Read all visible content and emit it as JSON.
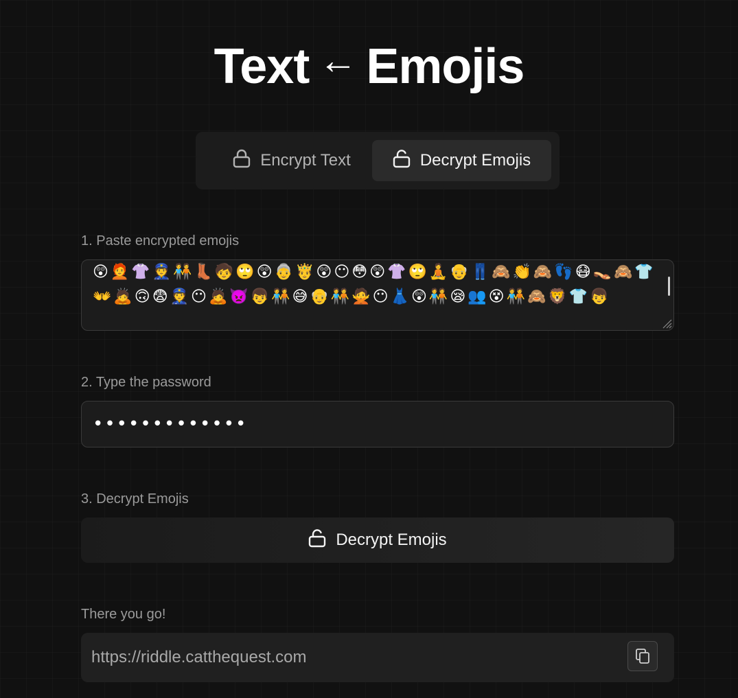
{
  "title": {
    "left": "Text",
    "arrow": "←",
    "right": "Emojis"
  },
  "tabs": {
    "encrypt": {
      "label": "Encrypt Text",
      "icon": "lock-icon",
      "active": false
    },
    "decrypt": {
      "label": "Decrypt Emojis",
      "icon": "unlock-icon",
      "active": true
    }
  },
  "step1": {
    "label": "1. Paste encrypted emojis",
    "emojis": "😲🧑‍🦰👚👮🧑‍🤝‍🧑👢🧒🙄😲👵🤴😲😶😳😲👚🙄🧘👴👖🙈👏🙈👣😷👡🙈👕👐🙇🙃😨👮😶🙇👿👦🧑‍🤝‍🧑😅👴🧑‍🤝‍🧑🙅😶👗😲🧑‍🤝‍🧑😪👥😵🧑‍🤝‍🧑🙈🦁👕👦"
  },
  "step2": {
    "label": "2. Type the password",
    "value": "abcdefghijklm"
  },
  "step3": {
    "label": "3. Decrypt Emojis",
    "button_label": "Decrypt Emojis",
    "button_icon": "unlock-icon"
  },
  "result": {
    "label": "There you go!",
    "value": "https://riddle.catthequest.com",
    "copy_icon": "copy-icon"
  },
  "colors": {
    "background": "#111111",
    "panel": "#1c1c1c",
    "active_tab": "#2b2b2b",
    "muted_text": "#9b9b9b"
  }
}
